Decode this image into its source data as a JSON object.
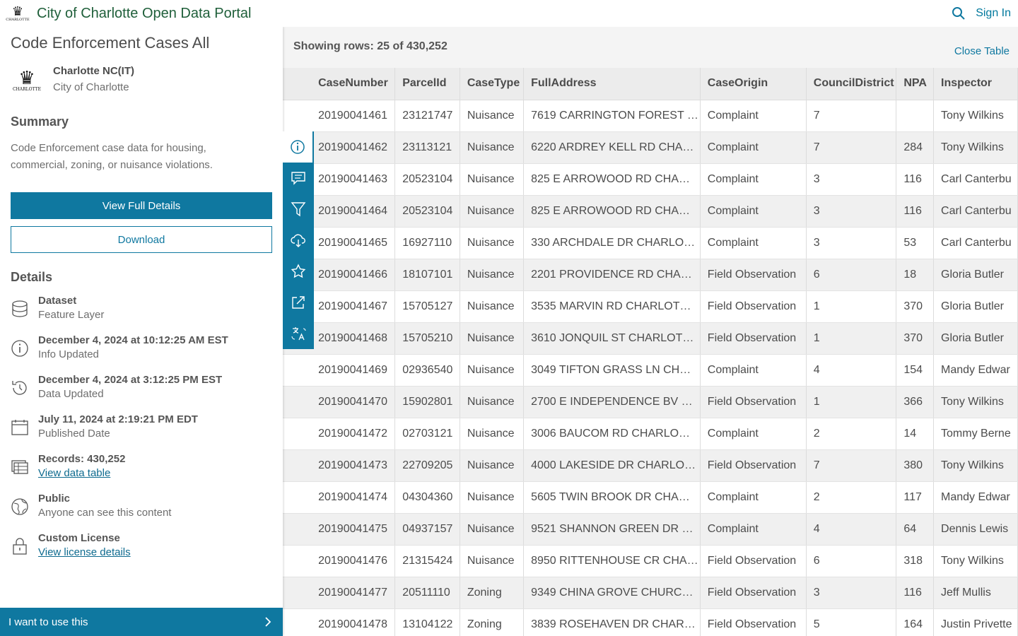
{
  "header": {
    "title": "City of Charlotte Open Data Portal",
    "sign_in": "Sign In",
    "logo_text": "CHARLOTTE"
  },
  "dataset": {
    "title": "Code Enforcement Cases All",
    "owner_name": "Charlotte NC(IT)",
    "owner_org": "City of Charlotte",
    "summary_heading": "Summary",
    "summary_text": "Code Enforcement case data for housing, commercial, zoning, or nuisance violations.",
    "view_full_details": "View Full Details",
    "download": "Download",
    "details_heading": "Details",
    "details": [
      {
        "icon": "database-icon",
        "main": "Dataset",
        "sub": "Feature Layer"
      },
      {
        "icon": "info-icon",
        "main": "December 4, 2024 at 10:12:25 AM EST",
        "sub": "Info Updated"
      },
      {
        "icon": "history-icon",
        "main": "December 4, 2024 at 3:12:25 PM EST",
        "sub": "Data Updated"
      },
      {
        "icon": "calendar-icon",
        "main": "July 11, 2024 at 2:19:21 PM EDT",
        "sub": "Published Date"
      },
      {
        "icon": "table-icon",
        "main": "Records: 430,252",
        "link": "View data table"
      },
      {
        "icon": "globe-icon",
        "main": "Public",
        "sub": "Anyone can see this content"
      },
      {
        "icon": "lock-icon",
        "main": "Custom License",
        "link": "View license details"
      }
    ],
    "use_bar": "I want to use this"
  },
  "table": {
    "rows_label": "Showing rows: 25 of 430,252",
    "close_label": "Close Table",
    "columns": [
      "CaseNumber",
      "ParcelId",
      "CaseType",
      "FullAddress",
      "CaseOrigin",
      "CouncilDistrict",
      "NPA",
      "Inspector"
    ],
    "rows": [
      [
        "20190041461",
        "23121747",
        "Nuisance",
        "7619 CARRINGTON FOREST …",
        "Complaint",
        "7",
        "",
        "Tony Wilkins"
      ],
      [
        "20190041462",
        "23113121",
        "Nuisance",
        "6220 ARDREY KELL RD CHA…",
        "Complaint",
        "7",
        "284",
        "Tony Wilkins"
      ],
      [
        "20190041463",
        "20523104",
        "Nuisance",
        "825 E ARROWOOD RD CHA…",
        "Complaint",
        "3",
        "116",
        "Carl Canterbu"
      ],
      [
        "20190041464",
        "20523104",
        "Nuisance",
        "825 E ARROWOOD RD CHA…",
        "Complaint",
        "3",
        "116",
        "Carl Canterbu"
      ],
      [
        "20190041465",
        "16927110",
        "Nuisance",
        "330 ARCHDALE DR CHARLO…",
        "Complaint",
        "3",
        "53",
        "Carl Canterbu"
      ],
      [
        "20190041466",
        "18107101",
        "Nuisance",
        "2201 PROVIDENCE RD CHA…",
        "Field Observation",
        "6",
        "18",
        "Gloria Butler"
      ],
      [
        "20190041467",
        "15705127",
        "Nuisance",
        "3535 MARVIN RD CHARLOT…",
        "Field Observation",
        "1",
        "370",
        "Gloria Butler"
      ],
      [
        "20190041468",
        "15705210",
        "Nuisance",
        "3610 JONQUIL ST CHARLOT…",
        "Field Observation",
        "1",
        "370",
        "Gloria Butler"
      ],
      [
        "20190041469",
        "02936540",
        "Nuisance",
        "3049 TIFTON GRASS LN CH…",
        "Complaint",
        "4",
        "154",
        "Mandy Edwar"
      ],
      [
        "20190041470",
        "15902801",
        "Nuisance",
        "2700 E INDEPENDENCE BV …",
        "Field Observation",
        "1",
        "366",
        "Tony Wilkins"
      ],
      [
        "20190041472",
        "02703121",
        "Nuisance",
        "3006 BAUCOM RD CHARLO…",
        "Complaint",
        "2",
        "14",
        "Tommy Berne"
      ],
      [
        "20190041473",
        "22709205",
        "Nuisance",
        "4000 LAKESIDE DR CHARLO…",
        "Field Observation",
        "7",
        "380",
        "Tony Wilkins"
      ],
      [
        "20190041474",
        "04304360",
        "Nuisance",
        "5605 TWIN BROOK DR CHA…",
        "Complaint",
        "2",
        "117",
        "Mandy Edwar"
      ],
      [
        "20190041475",
        "04937157",
        "Nuisance",
        "9521 SHANNON GREEN DR …",
        "Complaint",
        "4",
        "64",
        "Dennis Lewis"
      ],
      [
        "20190041476",
        "21315424",
        "Nuisance",
        "8950 RITTENHOUSE CR CHA…",
        "Field Observation",
        "6",
        "318",
        "Tony Wilkins"
      ],
      [
        "20190041477",
        "20511110",
        "Zoning",
        "9349 CHINA GROVE CHURC…",
        "Field Observation",
        "3",
        "116",
        "Jeff Mullis"
      ],
      [
        "20190041478",
        "13104122",
        "Zoning",
        "3839 ROSEHAVEN DR CHAR…",
        "Field Observation",
        "5",
        "164",
        "Justin Privette"
      ]
    ]
  },
  "side_strip": [
    "info-icon",
    "comment-icon",
    "filter-icon",
    "download-cloud-icon",
    "star-icon",
    "share-icon",
    "translate-icon"
  ],
  "colors": {
    "accent": "#0f78a0",
    "title_green": "#1f5f3a"
  }
}
